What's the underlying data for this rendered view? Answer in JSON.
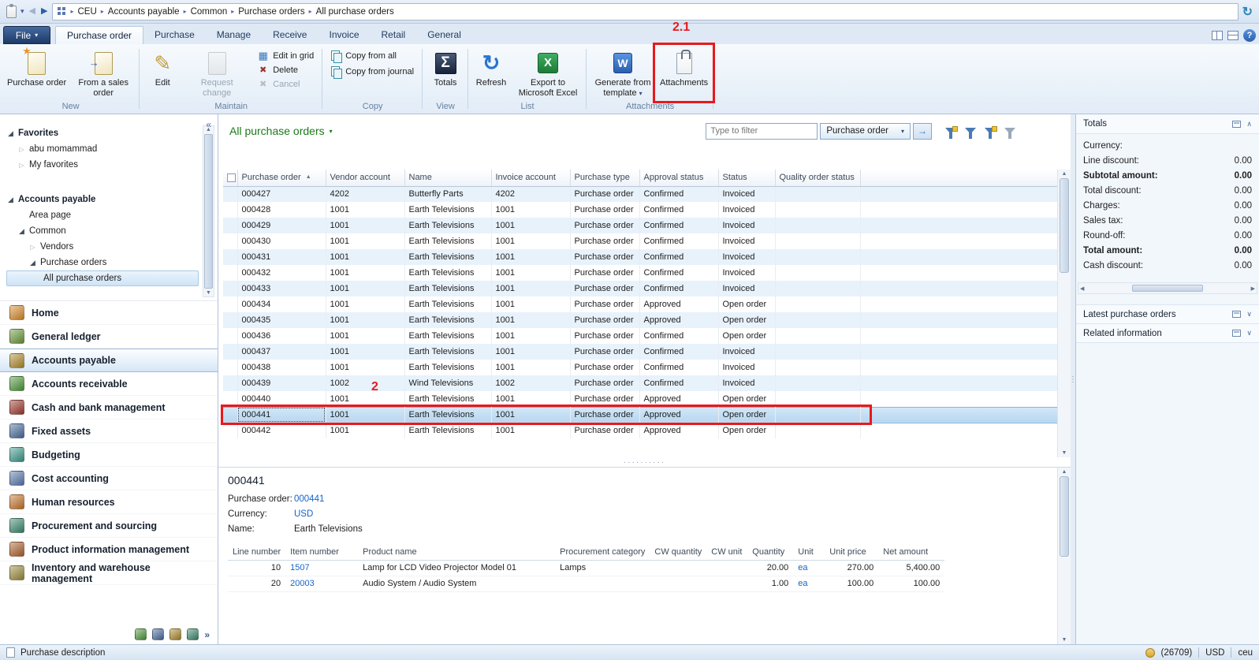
{
  "topbar": {
    "breadcrumb": [
      "CEU",
      "Accounts payable",
      "Common",
      "Purchase orders",
      "All purchase orders"
    ]
  },
  "ribbon": {
    "file_label": "File",
    "tabs": [
      {
        "label": "Purchase order",
        "active": true
      },
      {
        "label": "Purchase",
        "active": false
      },
      {
        "label": "Manage",
        "active": false
      },
      {
        "label": "Receive",
        "active": false
      },
      {
        "label": "Invoice",
        "active": false
      },
      {
        "label": "Retail",
        "active": false
      },
      {
        "label": "General",
        "active": false
      }
    ],
    "groups": {
      "new": {
        "label": "New",
        "purchase_order": "Purchase order",
        "from_sales_order": "From a sales order"
      },
      "maintain": {
        "label": "Maintain",
        "edit": "Edit",
        "request_change": "Request change",
        "edit_in_grid": "Edit in grid",
        "del": "Delete",
        "cancel": "Cancel"
      },
      "copy": {
        "label": "Copy",
        "copy_from_all": "Copy from all",
        "copy_from_journal": "Copy from journal"
      },
      "view": {
        "label": "View",
        "totals": "Totals"
      },
      "list": {
        "label": "List",
        "refresh": "Refresh",
        "export_excel": "Export to Microsoft Excel"
      },
      "attachments": {
        "label": "Attachments",
        "generate": "Generate from template",
        "attachments": "Attachments"
      }
    }
  },
  "nav": {
    "favorites_label": "Favorites",
    "favorites": [
      "abu momammad",
      "My favorites"
    ],
    "section_label": "Accounts payable",
    "tree": {
      "area_page": "Area page",
      "common": "Common",
      "vendors": "Vendors",
      "purchase_orders": "Purchase orders",
      "all_purchase_orders": "All purchase orders"
    },
    "modules": [
      {
        "label": "Home",
        "icon": "home-icon",
        "color": "#d98c2b",
        "active": false
      },
      {
        "label": "General ledger",
        "icon": "general-ledger-icon",
        "color": "#6b9a3c",
        "active": false
      },
      {
        "label": "Accounts payable",
        "icon": "accounts-payable-icon",
        "color": "#b08c2e",
        "active": true
      },
      {
        "label": "Accounts receivable",
        "icon": "accounts-receivable-icon",
        "color": "#4f9a3c",
        "active": false
      },
      {
        "label": "Cash and bank management",
        "icon": "cash-bank-icon",
        "color": "#a03a2e",
        "active": false
      },
      {
        "label": "Fixed assets",
        "icon": "fixed-assets-icon",
        "color": "#4a6d9e",
        "active": false
      },
      {
        "label": "Budgeting",
        "icon": "budgeting-icon",
        "color": "#3c9a8c",
        "active": false
      },
      {
        "label": "Cost accounting",
        "icon": "cost-accounting-icon",
        "color": "#5a7ab0",
        "active": false
      },
      {
        "label": "Human resources",
        "icon": "human-resources-icon",
        "color": "#c8762b",
        "active": false
      },
      {
        "label": "Procurement and sourcing",
        "icon": "procurement-icon",
        "color": "#3c8a6e",
        "active": false
      },
      {
        "label": "Product information management",
        "icon": "product-information-icon",
        "color": "#b0622e",
        "active": false
      },
      {
        "label": "Inventory and warehouse management",
        "icon": "inventory-icon",
        "color": "#9a8c3c",
        "active": false
      }
    ]
  },
  "content": {
    "title": "All purchase orders",
    "filter_placeholder": "Type to filter",
    "filter_scope": "Purchase order",
    "grid": {
      "columns": [
        "Purchase order",
        "Vendor account",
        "Name",
        "Invoice account",
        "Purchase type",
        "Approval status",
        "Status",
        "Quality order status"
      ],
      "rows": [
        {
          "po": "000427",
          "vendor": "4202",
          "name": "Butterfly Parts",
          "invoice": "4202",
          "type": "Purchase order",
          "approval": "Confirmed",
          "status": "Invoiced",
          "quality": "",
          "selected": false
        },
        {
          "po": "000428",
          "vendor": "1001",
          "name": "Earth Televisions",
          "invoice": "1001",
          "type": "Purchase order",
          "approval": "Confirmed",
          "status": "Invoiced",
          "quality": "",
          "selected": false
        },
        {
          "po": "000429",
          "vendor": "1001",
          "name": "Earth Televisions",
          "invoice": "1001",
          "type": "Purchase order",
          "approval": "Confirmed",
          "status": "Invoiced",
          "quality": "",
          "selected": false
        },
        {
          "po": "000430",
          "vendor": "1001",
          "name": "Earth Televisions",
          "invoice": "1001",
          "type": "Purchase order",
          "approval": "Confirmed",
          "status": "Invoiced",
          "quality": "",
          "selected": false
        },
        {
          "po": "000431",
          "vendor": "1001",
          "name": "Earth Televisions",
          "invoice": "1001",
          "type": "Purchase order",
          "approval": "Confirmed",
          "status": "Invoiced",
          "quality": "",
          "selected": false
        },
        {
          "po": "000432",
          "vendor": "1001",
          "name": "Earth Televisions",
          "invoice": "1001",
          "type": "Purchase order",
          "approval": "Confirmed",
          "status": "Invoiced",
          "quality": "",
          "selected": false
        },
        {
          "po": "000433",
          "vendor": "1001",
          "name": "Earth Televisions",
          "invoice": "1001",
          "type": "Purchase order",
          "approval": "Confirmed",
          "status": "Invoiced",
          "quality": "",
          "selected": false
        },
        {
          "po": "000434",
          "vendor": "1001",
          "name": "Earth Televisions",
          "invoice": "1001",
          "type": "Purchase order",
          "approval": "Approved",
          "status": "Open order",
          "quality": "",
          "selected": false
        },
        {
          "po": "000435",
          "vendor": "1001",
          "name": "Earth Televisions",
          "invoice": "1001",
          "type": "Purchase order",
          "approval": "Approved",
          "status": "Open order",
          "quality": "",
          "selected": false
        },
        {
          "po": "000436",
          "vendor": "1001",
          "name": "Earth Televisions",
          "invoice": "1001",
          "type": "Purchase order",
          "approval": "Confirmed",
          "status": "Open order",
          "quality": "",
          "selected": false
        },
        {
          "po": "000437",
          "vendor": "1001",
          "name": "Earth Televisions",
          "invoice": "1001",
          "type": "Purchase order",
          "approval": "Confirmed",
          "status": "Invoiced",
          "quality": "",
          "selected": false
        },
        {
          "po": "000438",
          "vendor": "1001",
          "name": "Earth Televisions",
          "invoice": "1001",
          "type": "Purchase order",
          "approval": "Confirmed",
          "status": "Invoiced",
          "quality": "",
          "selected": false
        },
        {
          "po": "000439",
          "vendor": "1002",
          "name": "Wind Televisions",
          "invoice": "1002",
          "type": "Purchase order",
          "approval": "Confirmed",
          "status": "Invoiced",
          "quality": "",
          "selected": false
        },
        {
          "po": "000440",
          "vendor": "1001",
          "name": "Earth Televisions",
          "invoice": "1001",
          "type": "Purchase order",
          "approval": "Approved",
          "status": "Open order",
          "quality": "",
          "selected": false
        },
        {
          "po": "000441",
          "vendor": "1001",
          "name": "Earth Televisions",
          "invoice": "1001",
          "type": "Purchase order",
          "approval": "Approved",
          "status": "Open order",
          "quality": "",
          "selected": true
        },
        {
          "po": "000442",
          "vendor": "1001",
          "name": "Earth Televisions",
          "invoice": "1001",
          "type": "Purchase order",
          "approval": "Approved",
          "status": "Open order",
          "quality": "",
          "selected": false
        }
      ]
    },
    "detail": {
      "title": "000441",
      "fields": [
        {
          "label": "Purchase order:",
          "value": "000441"
        },
        {
          "label": "Currency:",
          "value": "USD"
        },
        {
          "label": "Name:",
          "value": "Earth Televisions"
        }
      ],
      "lines": {
        "columns": [
          "Line number",
          "Item number",
          "Product name",
          "Procurement category",
          "CW quantity",
          "CW unit",
          "Quantity",
          "Unit",
          "Unit price",
          "Net amount"
        ],
        "rows": [
          {
            "line": "10",
            "item": "1507",
            "product": "Lamp for LCD Video Projector Model 01",
            "category": "Lamps",
            "cw_qty": "",
            "cw_unit": "",
            "qty": "20.00",
            "unit": "ea",
            "price": "270.00",
            "net": "5,400.00"
          },
          {
            "line": "20",
            "item": "20003",
            "product": "Audio System / Audio System",
            "category": "",
            "cw_qty": "",
            "cw_unit": "",
            "qty": "1.00",
            "unit": "ea",
            "price": "100.00",
            "net": "100.00"
          }
        ]
      }
    }
  },
  "panel": {
    "totals_title": "Totals",
    "rows": [
      {
        "label": "Currency:",
        "value": "",
        "bold": false
      },
      {
        "label": "Line discount:",
        "value": "0.00",
        "bold": false
      },
      {
        "label": "Subtotal amount:",
        "value": "0.00",
        "bold": true
      },
      {
        "label": "Total discount:",
        "value": "0.00",
        "bold": false
      },
      {
        "label": "Charges:",
        "value": "0.00",
        "bold": false
      },
      {
        "label": "Sales tax:",
        "value": "0.00",
        "bold": false
      },
      {
        "label": "Round-off:",
        "value": "0.00",
        "bold": false
      },
      {
        "label": "Total amount:",
        "value": "0.00",
        "bold": true
      },
      {
        "label": "Cash discount:",
        "value": "0.00",
        "bold": false
      }
    ],
    "sections": [
      "Latest purchase orders",
      "Related information"
    ]
  },
  "statusbar": {
    "left": "Purchase description",
    "user_count": "(26709)",
    "currency": "USD",
    "company": "ceu"
  },
  "annotations": {
    "attachments_step": "2.1",
    "row_step": "2",
    "color": "#e8191c"
  }
}
